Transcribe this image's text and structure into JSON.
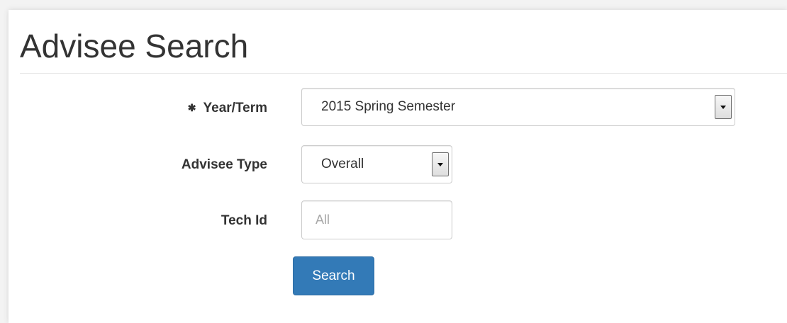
{
  "page": {
    "title": "Advisee Search"
  },
  "form": {
    "year_term": {
      "label": "Year/Term",
      "required_icon": "✱",
      "value": "2015 Spring Semester"
    },
    "advisee_type": {
      "label": "Advisee Type",
      "value": "Overall"
    },
    "tech_id": {
      "label": "Tech Id",
      "placeholder": "All",
      "value": ""
    },
    "search_button_label": "Search"
  },
  "colors": {
    "primary_button": "#337ab7",
    "text": "#333333",
    "placeholder": "#a8a8a8"
  },
  "icons": {
    "required": "asterisk-icon",
    "dropdown": "chevron-down-icon"
  }
}
